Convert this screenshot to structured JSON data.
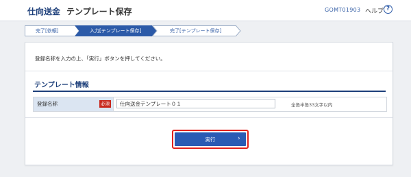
{
  "header": {
    "app_name": "仕向送金",
    "page_title": "テンプレート保存",
    "screen_id": "GOMT01903",
    "help_label": "ヘルプ",
    "help_icon": "?"
  },
  "steps": [
    {
      "label": "完了[依頼]",
      "state": "done"
    },
    {
      "label": "入力[テンプレート保存]",
      "state": "active"
    },
    {
      "label": "完了[テンプレート保存]",
      "state": "done"
    }
  ],
  "instruction": "登録名称を入力の上、「実行」ボタンを押してください。",
  "section": {
    "title": "テンプレート情報"
  },
  "form": {
    "label": "登録名称",
    "required_badge": "必須",
    "input_value": "仕向送金テンプレート０１",
    "hint": "全角半角33文字以内"
  },
  "actions": {
    "execute_label": "実行",
    "execute_chevron": "›"
  },
  "colors": {
    "brand": "#1d3f7a",
    "step_active": "#2c5aa8",
    "button": "#2a5bb4",
    "required": "#c8281e",
    "highlight": "#e2211c"
  }
}
